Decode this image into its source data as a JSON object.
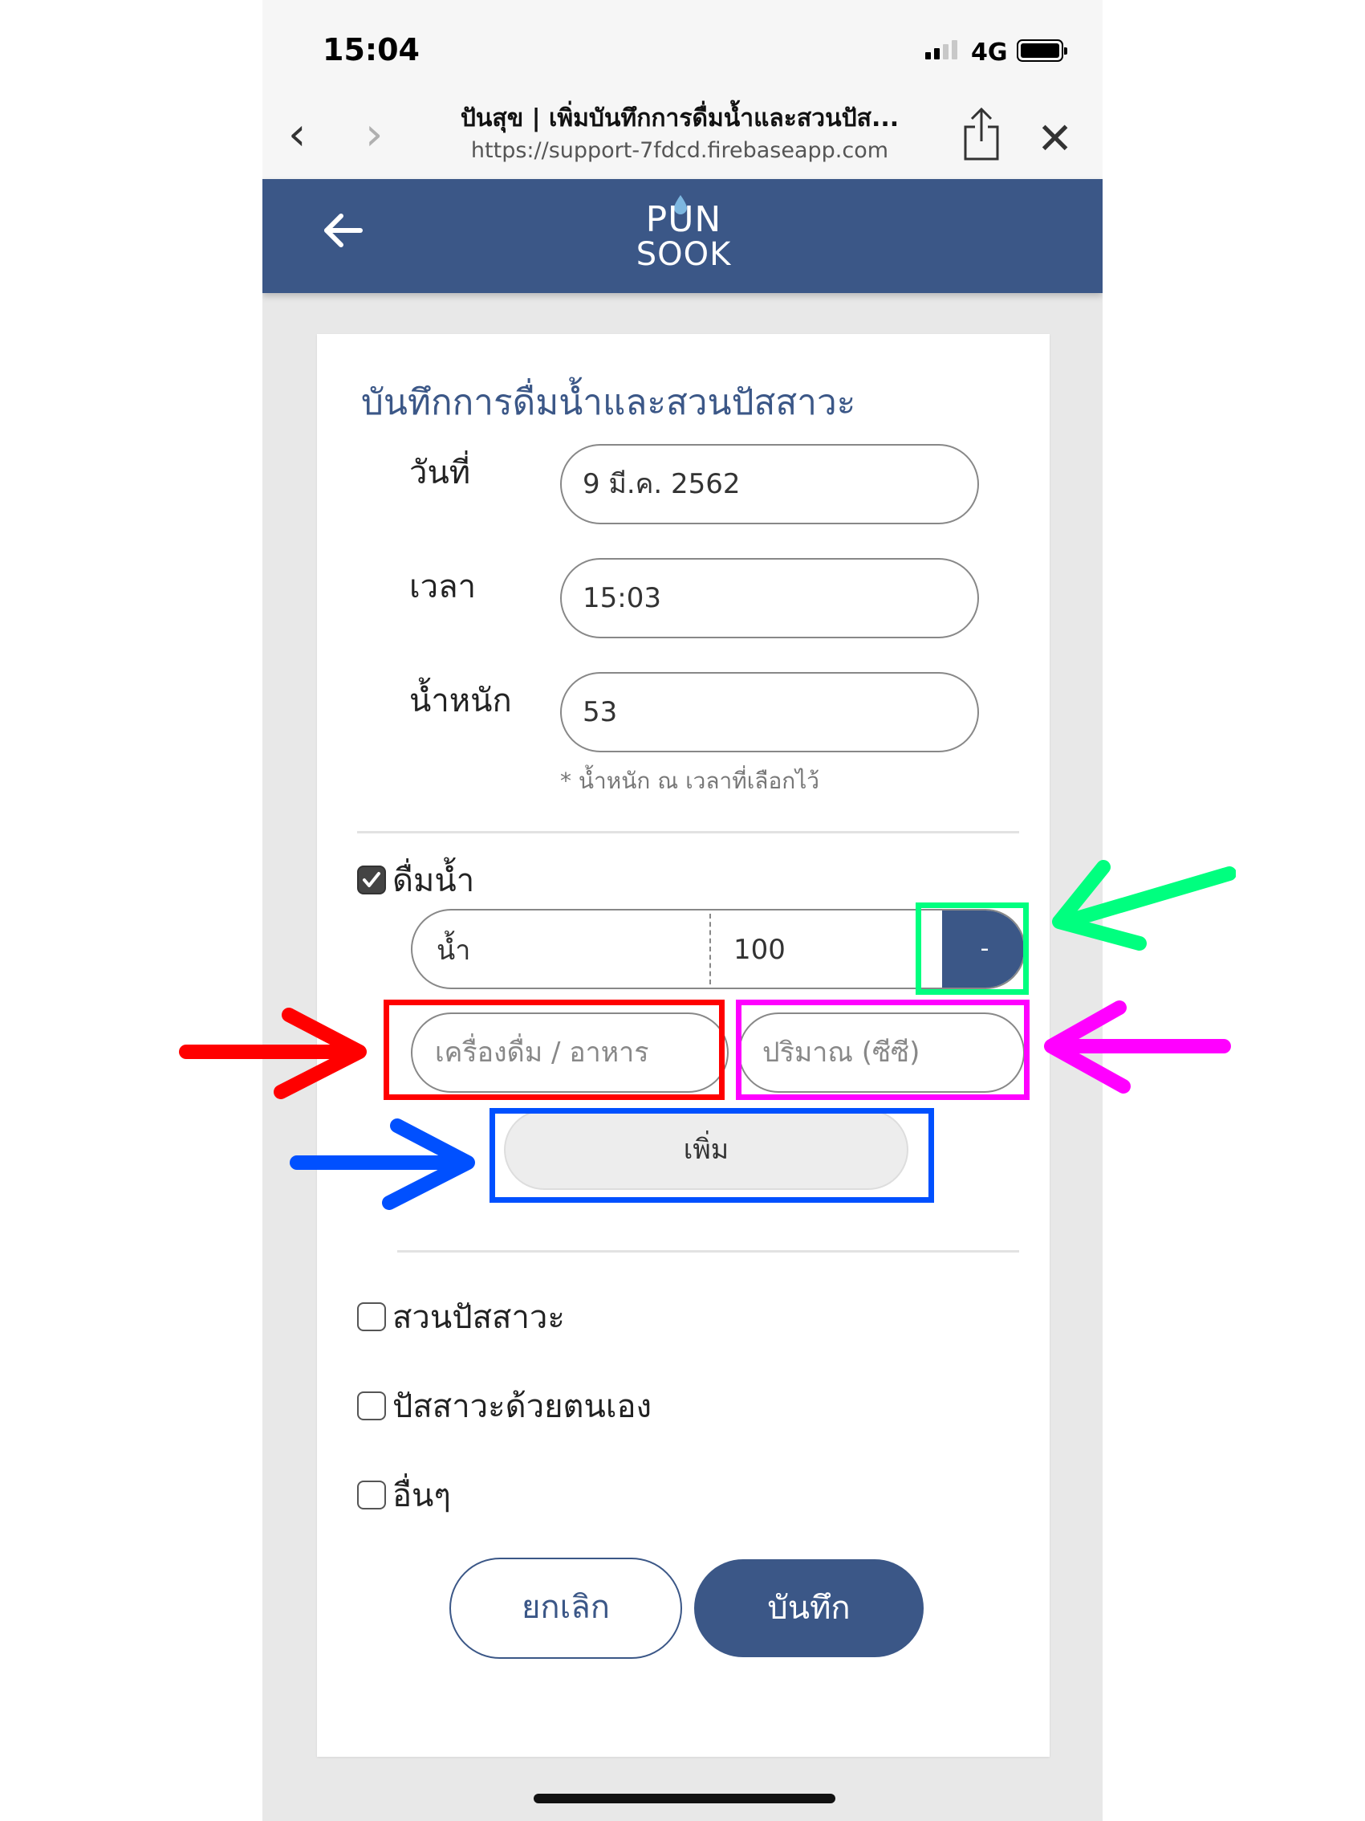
{
  "status": {
    "time": "15:04",
    "network": "4G"
  },
  "browser": {
    "title": "ปันสุข | เพิ่มบันทึกการดื่มน้ำและสวนปัส...",
    "url": "https://support-7fdcd.firebaseapp.com"
  },
  "app": {
    "logo_line1": "PUN",
    "logo_line2": "SOOK"
  },
  "form": {
    "title": "บันทึกการดื่มน้ำและสวนปัสสาวะ",
    "date_label": "วันที่",
    "date_value": "9 มี.ค. 2562",
    "time_label": "เวลา",
    "time_value": "15:03",
    "weight_label": "น้ำหนัก",
    "weight_value": "53",
    "weight_note": "* น้ำหนัก ณ เวลาที่เลือกไว้"
  },
  "drink": {
    "checkbox_label": "ดื่มน้ำ",
    "checked": true,
    "items": [
      {
        "name": "น้ำ",
        "amount": "100",
        "remove_label": "-"
      }
    ],
    "drink_placeholder": "เครื่องดื่ม / อาหาร",
    "amount_placeholder": "ปริมาณ (ซีซี)",
    "add_label": "เพิ่ม"
  },
  "options": [
    {
      "label": "สวนปัสสาวะ",
      "checked": false
    },
    {
      "label": "ปัสสาวะด้วยตนเอง",
      "checked": false
    },
    {
      "label": "อื่นๆ",
      "checked": false
    }
  ],
  "actions": {
    "cancel_label": "ยกเลิก",
    "save_label": "บันทึก"
  },
  "colors": {
    "brand": "#3b5787",
    "annotation_green": "#00ff7f",
    "annotation_red": "#ff0000",
    "annotation_magenta": "#ff00ff",
    "annotation_blue": "#0050ff"
  }
}
